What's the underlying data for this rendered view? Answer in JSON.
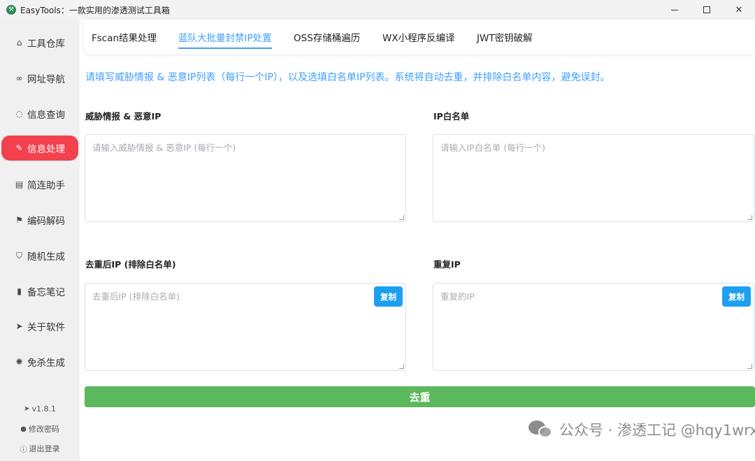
{
  "window": {
    "title": "EasyTools：一款实用的渗透测试工具箱",
    "controls": {
      "minimize": "—",
      "maximize": "□",
      "close": "✕"
    }
  },
  "sidebar": {
    "items": [
      {
        "label": "工具仓库",
        "icon": "box-icon",
        "glyph": "⌂"
      },
      {
        "label": "网址导航",
        "icon": "link-icon",
        "glyph": "∞"
      },
      {
        "label": "信息查询",
        "icon": "chat-icon",
        "glyph": "◌"
      },
      {
        "label": "信息处理",
        "icon": "edit-icon",
        "glyph": "✎"
      },
      {
        "label": "简连助手",
        "icon": "doc-icon",
        "glyph": "▤"
      },
      {
        "label": "编码解码",
        "icon": "flag-icon",
        "glyph": "⚑"
      },
      {
        "label": "随机生成",
        "icon": "shield-icon",
        "glyph": "⛉"
      },
      {
        "label": "备忘笔记",
        "icon": "chart-icon",
        "glyph": "▮"
      },
      {
        "label": "关于软件",
        "icon": "send-icon",
        "glyph": "➤"
      },
      {
        "label": "免杀生成",
        "icon": "bug-icon",
        "glyph": "✺"
      }
    ],
    "active_index": 3,
    "version": "v1.8.1",
    "change_password": "修改密码",
    "logout": "退出登录"
  },
  "tabs": [
    {
      "label": "Fscan结果处理"
    },
    {
      "label": "蓝队大批量封禁IP处置"
    },
    {
      "label": "OSS存储桶遍历"
    },
    {
      "label": "WX小程序反编译"
    },
    {
      "label": "JWT密钥破解"
    }
  ],
  "active_tab": 1,
  "main": {
    "hint": "请填写威胁情报 & 恶意IP列表（每行一个IP），以及选填白名单IP列表。系统将自动去重，并排除白名单内容，避免误封。",
    "threat": {
      "label": "威胁情报 & 恶意IP",
      "placeholder": "请输入威胁情报 & 恶意IP (每行一个)",
      "value": ""
    },
    "whitelist": {
      "label": "IP白名单",
      "placeholder": "请输入IP白名单 (每行一个)",
      "value": ""
    },
    "dedup_result": {
      "label": "去重后IP (排除白名单)",
      "placeholder": "去重后IP (排除白名单)",
      "copy_label": "复制"
    },
    "duplicates": {
      "label": "重复IP",
      "placeholder": "重复的IP",
      "copy_label": "复制"
    },
    "dedup_button": "去重"
  },
  "watermark": {
    "text": "公众号 · 渗透工记  @hqy1wrx"
  },
  "colors": {
    "accent": "#409eff",
    "active_nav": "#f2424e",
    "dedup_button": "#5cb85c",
    "copy_button": "#1ea0f0"
  }
}
